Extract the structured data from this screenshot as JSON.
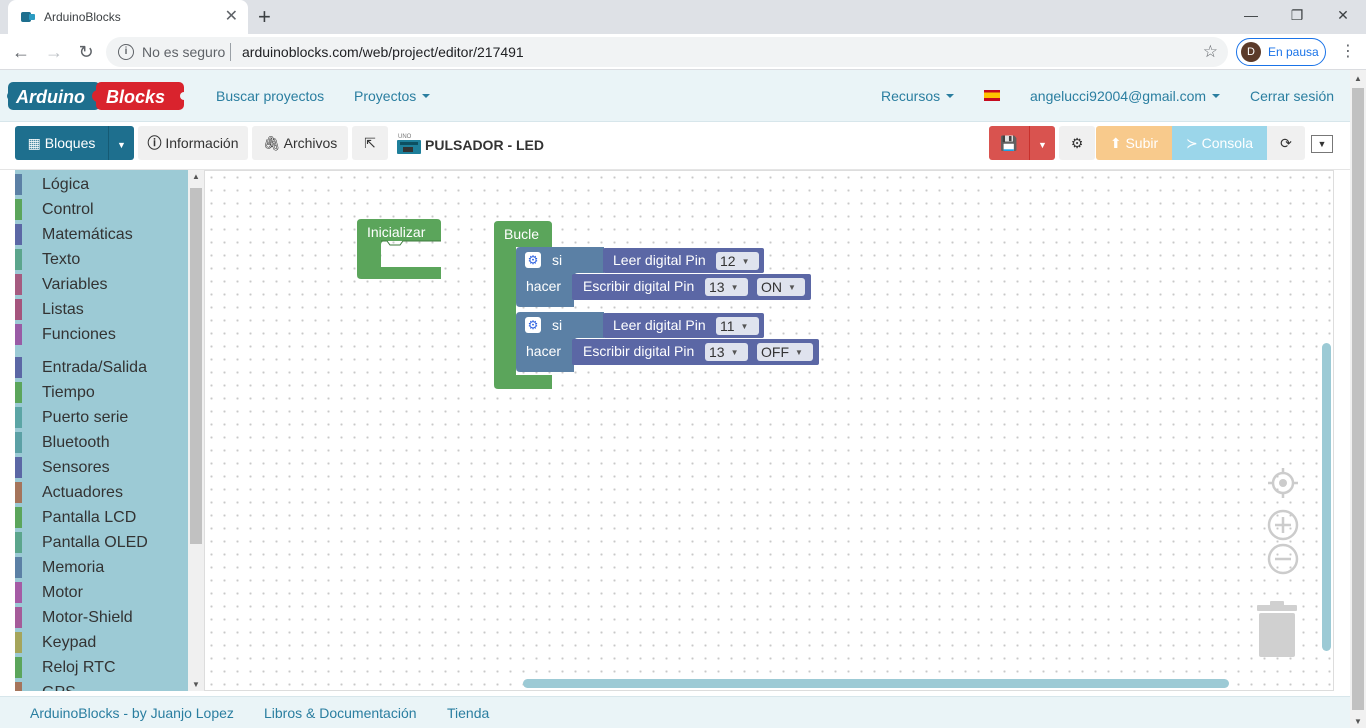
{
  "browser": {
    "tab_title": "ArduinoBlocks",
    "security": "No es seguro",
    "url": "arduinoblocks.com/web/project/editor/217491",
    "profile_initial": "D",
    "profile_status": "En pausa"
  },
  "navbar": {
    "logo_left": "Arduino",
    "logo_right": "Blocks",
    "search_projects": "Buscar proyectos",
    "projects": "Proyectos",
    "resources": "Recursos",
    "user_email": "angelucci92004@gmail.com",
    "logout": "Cerrar sesión"
  },
  "actionbar": {
    "blocks": "Bloques",
    "info": "Información",
    "files": "Archivos",
    "board_label": "UNO",
    "project_title": "PULSADOR - LED",
    "upload": "Subir",
    "console": "Consola"
  },
  "toolbox": {
    "categories": [
      {
        "label": "Lógica",
        "color": "#5b80a5"
      },
      {
        "label": "Control",
        "color": "#5ba55b"
      },
      {
        "label": "Matemáticas",
        "color": "#5b67a5"
      },
      {
        "label": "Texto",
        "color": "#5ba58c"
      },
      {
        "label": "Variables",
        "color": "#a55b80"
      },
      {
        "label": "Listas",
        "color": "#a5557d"
      },
      {
        "label": "Funciones",
        "color": "#995ba5"
      },
      {
        "label": "Entrada/Salida",
        "color": "#5b67a5"
      },
      {
        "label": "Tiempo",
        "color": "#5ba55b"
      },
      {
        "label": "Puerto serie",
        "color": "#5ba5a5"
      },
      {
        "label": "Bluetooth",
        "color": "#5ba0a5"
      },
      {
        "label": "Sensores",
        "color": "#5b67a5"
      },
      {
        "label": "Actuadores",
        "color": "#a5745b"
      },
      {
        "label": "Pantalla LCD",
        "color": "#5ba55b"
      },
      {
        "label": "Pantalla OLED",
        "color": "#5ba58c"
      },
      {
        "label": "Memoria",
        "color": "#5b80a5"
      },
      {
        "label": "Motor",
        "color": "#a55ba5"
      },
      {
        "label": "Motor-Shield",
        "color": "#a55b99"
      },
      {
        "label": "Keypad",
        "color": "#a5a55b"
      },
      {
        "label": "Reloj RTC",
        "color": "#5ba55b"
      },
      {
        "label": "GPS",
        "color": "#a5745b"
      }
    ]
  },
  "workspace": {
    "init_block": "Inicializar",
    "loop_block": "Bucle",
    "if1": {
      "si": "si",
      "hacer": "hacer",
      "read_label": "Leer digital Pin",
      "read_pin": "12",
      "write_label": "Escribir digital Pin",
      "write_pin": "13",
      "write_value": "ON"
    },
    "if2": {
      "si": "si",
      "hacer": "hacer",
      "read_label": "Leer digital Pin",
      "read_pin": "11",
      "write_label": "Escribir digital Pin",
      "write_pin": "13",
      "write_value": "OFF"
    },
    "colors": {
      "green": "#5ba55b",
      "io": "#5b67a5",
      "logic": "#5b80a5"
    }
  },
  "footer": {
    "credit": "ArduinoBlocks - by Juanjo Lopez",
    "docs": "Libros & Documentación",
    "shop": "Tienda"
  }
}
